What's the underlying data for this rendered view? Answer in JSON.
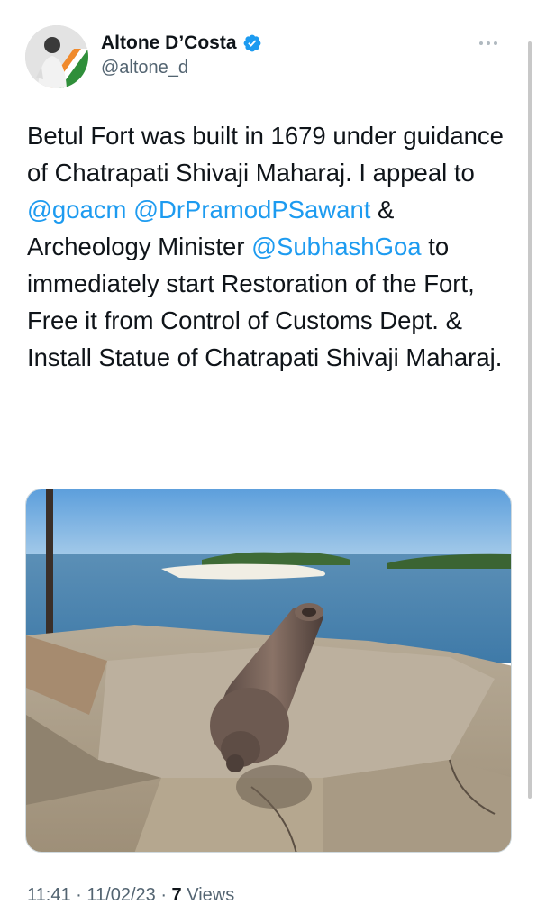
{
  "author": {
    "display_name": "Altone D’Costa",
    "handle": "@altone_d",
    "verified": true
  },
  "tweet": {
    "segments": [
      {
        "text": "Betul Fort was built in 1679 under guidance of Chatrapati Shivaji Maharaj. I appeal to ",
        "type": "text"
      },
      {
        "text": "@goacm",
        "type": "mention"
      },
      {
        "text": " ",
        "type": "text"
      },
      {
        "text": "@DrPramodPSawant",
        "type": "mention"
      },
      {
        "text": " & Archeology Minister ",
        "type": "text"
      },
      {
        "text": "@SubhashGoa",
        "type": "mention"
      },
      {
        "text": " to immediately start Restoration of the Fort, Free it from Control of Customs Dept. & Install Statue of Chatrapati Shivaji Maharaj.",
        "type": "text"
      }
    ]
  },
  "meta": {
    "time": "11:41",
    "date": "11/02/23",
    "separator": "·",
    "views_count": "7",
    "views_label": "Views"
  },
  "colors": {
    "accent": "#1d9bf0",
    "text": "#0f1419",
    "secondary": "#536471"
  },
  "icons": {
    "verified": "verified-badge-icon",
    "more": "more-options-icon"
  }
}
